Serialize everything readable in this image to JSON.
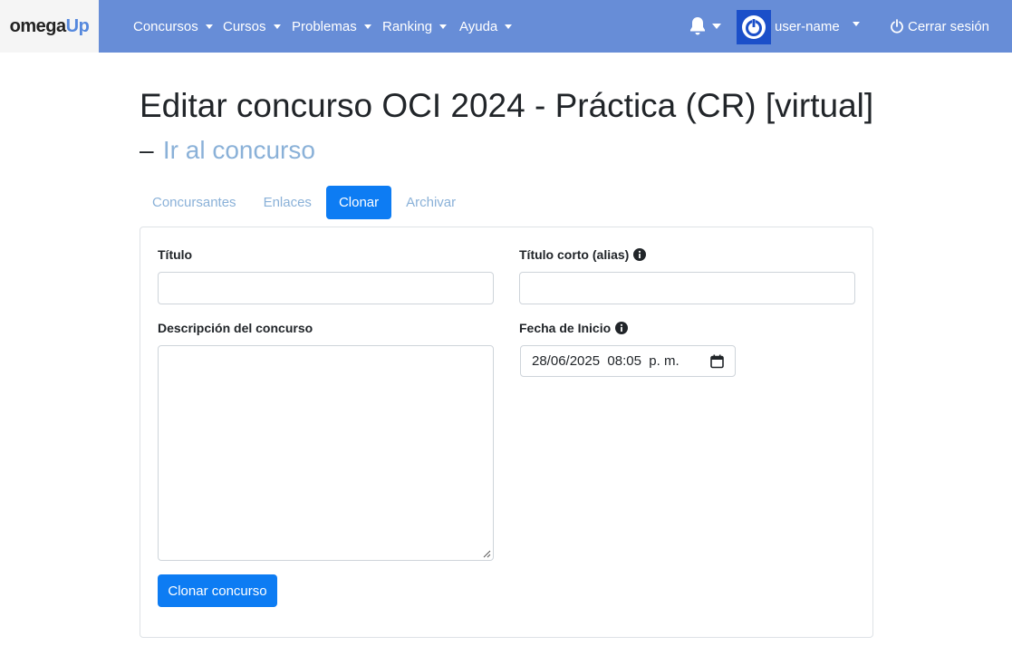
{
  "brand": {
    "part1": "omega",
    "part2": "Up"
  },
  "nav": {
    "items": [
      {
        "label": "Concursos"
      },
      {
        "label": "Cursos"
      },
      {
        "label": "Problemas"
      },
      {
        "label": "Ranking"
      },
      {
        "label": "Ayuda"
      }
    ],
    "username": "user-name",
    "logout": "Cerrar sesión"
  },
  "page": {
    "title": "Editar concurso OCI 2024 - Práctica (CR) [virtual]",
    "dash": "–",
    "goto_link": "Ir al concurso"
  },
  "tabs": [
    {
      "label": "Concursantes",
      "active": false
    },
    {
      "label": "Enlaces",
      "active": false
    },
    {
      "label": "Clonar",
      "active": true
    },
    {
      "label": "Archivar",
      "active": false
    }
  ],
  "form": {
    "title_label": "Título",
    "title_value": "",
    "alias_label": "Título corto (alias)",
    "alias_value": "",
    "description_label": "Descripción del concurso",
    "description_value": "",
    "start_label": "Fecha de Inicio",
    "start_value": "28/06/2025  08:05  p. m.",
    "submit": "Clonar concurso"
  },
  "colors": {
    "navbar": "#678dd7",
    "primary": "#0d7cf3",
    "link": "#8ab1d8"
  }
}
